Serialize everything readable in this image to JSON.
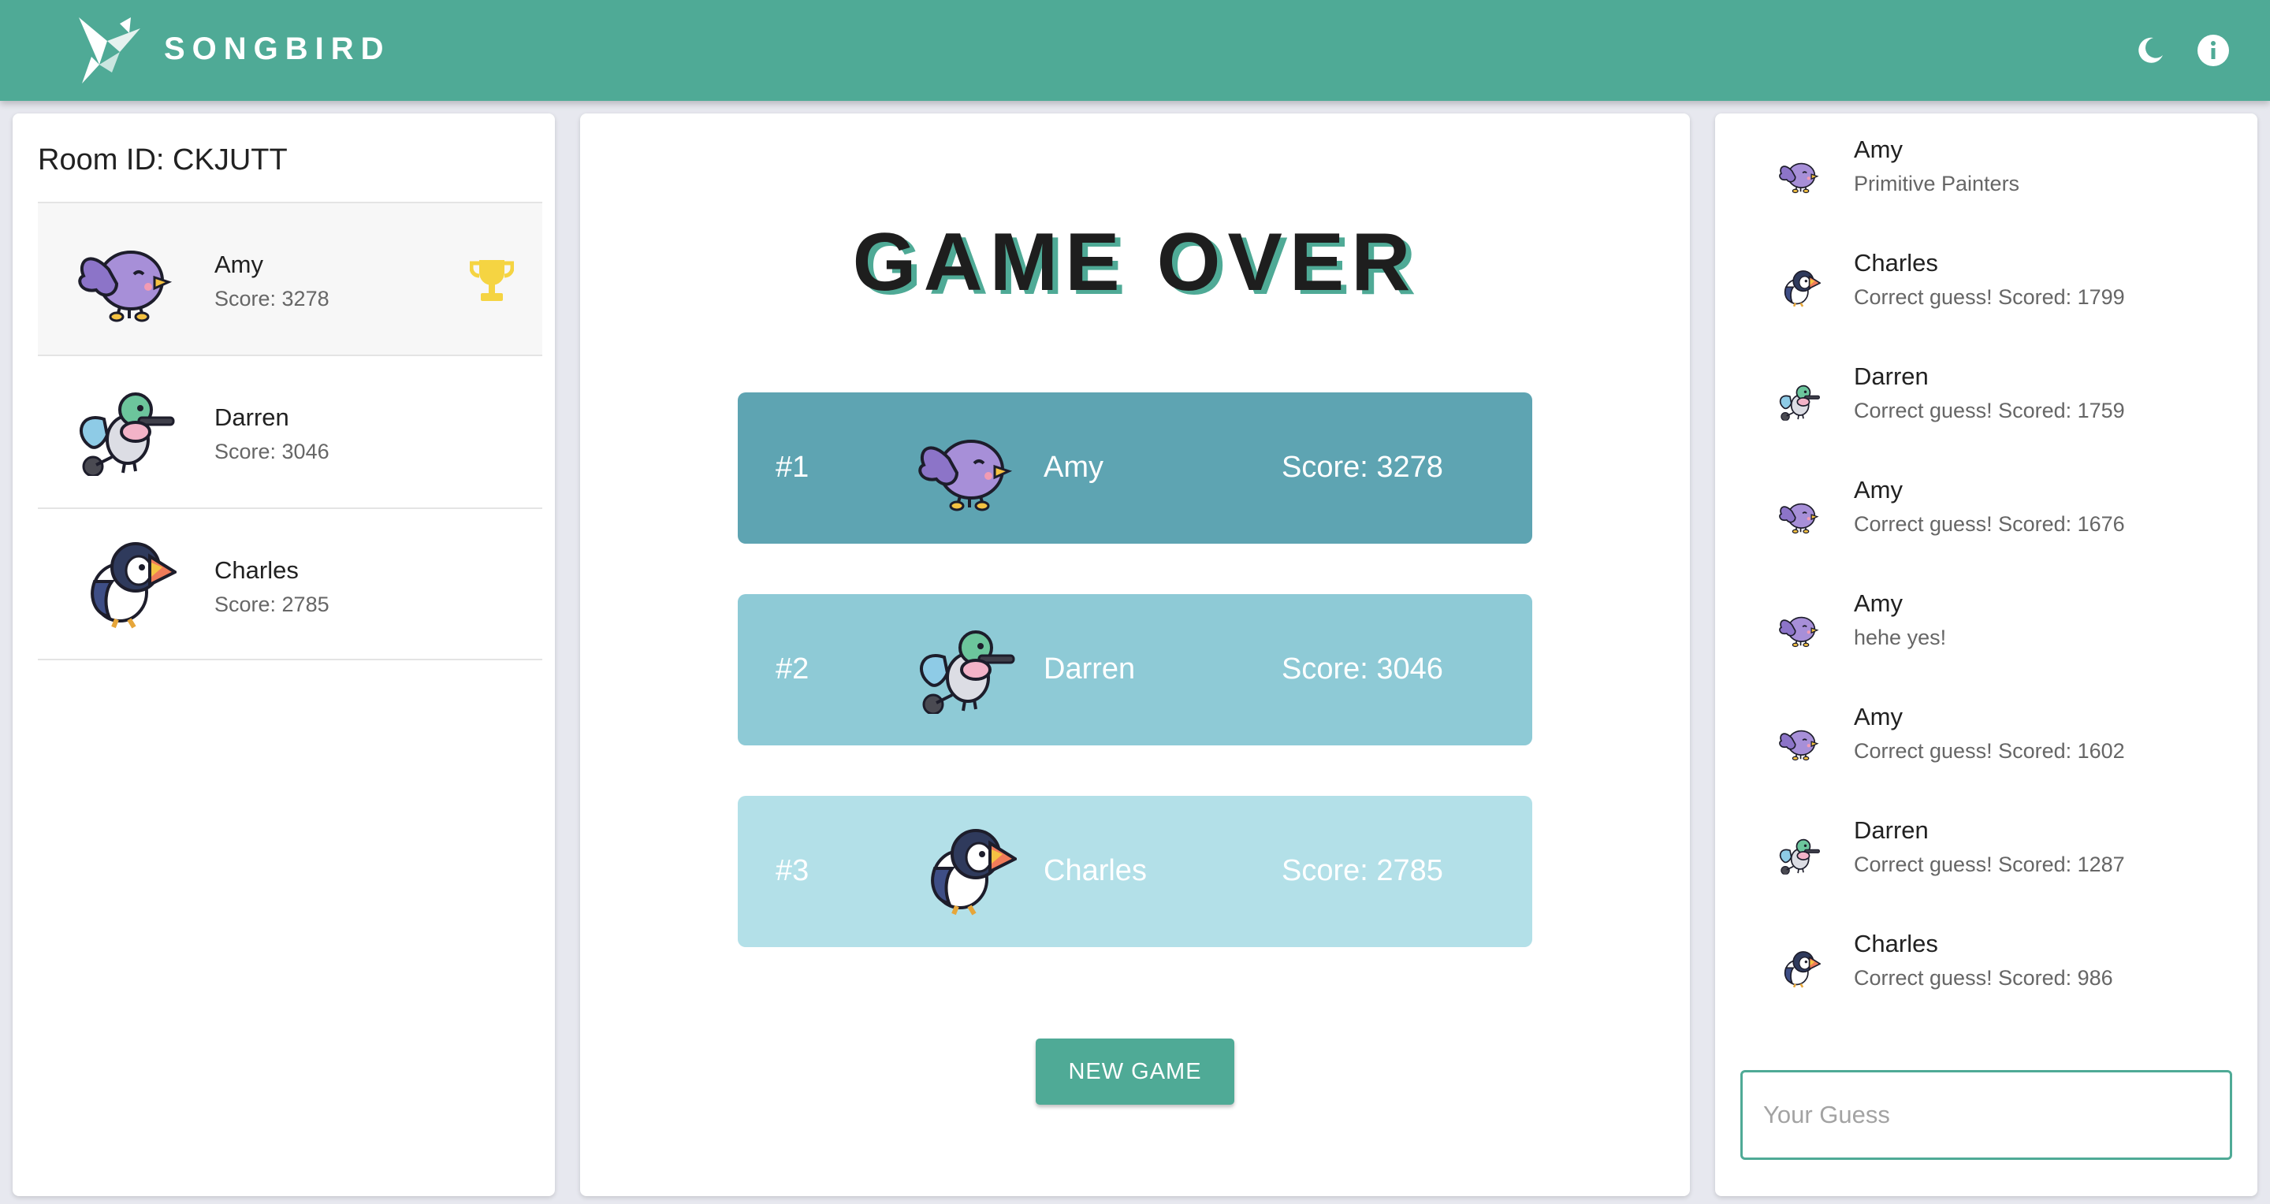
{
  "app": {
    "brand": "SONGBIRD",
    "logo_icon": "origami-bird-icon",
    "theme_icon": "moon-icon",
    "info_icon": "info-icon",
    "accent_color": "#4faa96"
  },
  "players_panel": {
    "room_id": "Room ID: CKJUTT",
    "players": [
      {
        "name": "Amy",
        "score": "Score: 3278",
        "avatar": "purple-bird",
        "leader": true,
        "badge_icon": "trophy-icon"
      },
      {
        "name": "Darren",
        "score": "Score: 3046",
        "avatar": "hummingbird"
      },
      {
        "name": "Charles",
        "score": "Score: 2785",
        "avatar": "puffin"
      }
    ]
  },
  "game": {
    "title": "GAME OVER",
    "rankings": [
      {
        "rank": "#1",
        "name": "Amy",
        "score": "Score: 3278",
        "avatar": "purple-bird",
        "color": "#5ea4b2"
      },
      {
        "rank": "#2",
        "name": "Darren",
        "score": "Score: 3046",
        "avatar": "hummingbird",
        "color": "#8ecad6"
      },
      {
        "rank": "#3",
        "name": "Charles",
        "score": "Score: 2785",
        "avatar": "puffin",
        "color": "#b3e0e8"
      }
    ],
    "new_game_label": "NEW GAME"
  },
  "chat": {
    "messages": [
      {
        "name": "Amy",
        "text": "Primitive Painters",
        "avatar": "purple-bird"
      },
      {
        "name": "Charles",
        "text": "Correct guess! Scored: 1799",
        "avatar": "puffin"
      },
      {
        "name": "Darren",
        "text": "Correct guess! Scored: 1759",
        "avatar": "hummingbird"
      },
      {
        "name": "Amy",
        "text": "Correct guess! Scored: 1676",
        "avatar": "purple-bird"
      },
      {
        "name": "Amy",
        "text": "hehe yes!",
        "avatar": "purple-bird"
      },
      {
        "name": "Amy",
        "text": "Correct guess! Scored: 1602",
        "avatar": "purple-bird"
      },
      {
        "name": "Darren",
        "text": "Correct guess! Scored: 1287",
        "avatar": "hummingbird"
      },
      {
        "name": "Charles",
        "text": "Correct guess! Scored: 986",
        "avatar": "puffin"
      }
    ],
    "input_placeholder": "Your Guess",
    "input_value": ""
  }
}
